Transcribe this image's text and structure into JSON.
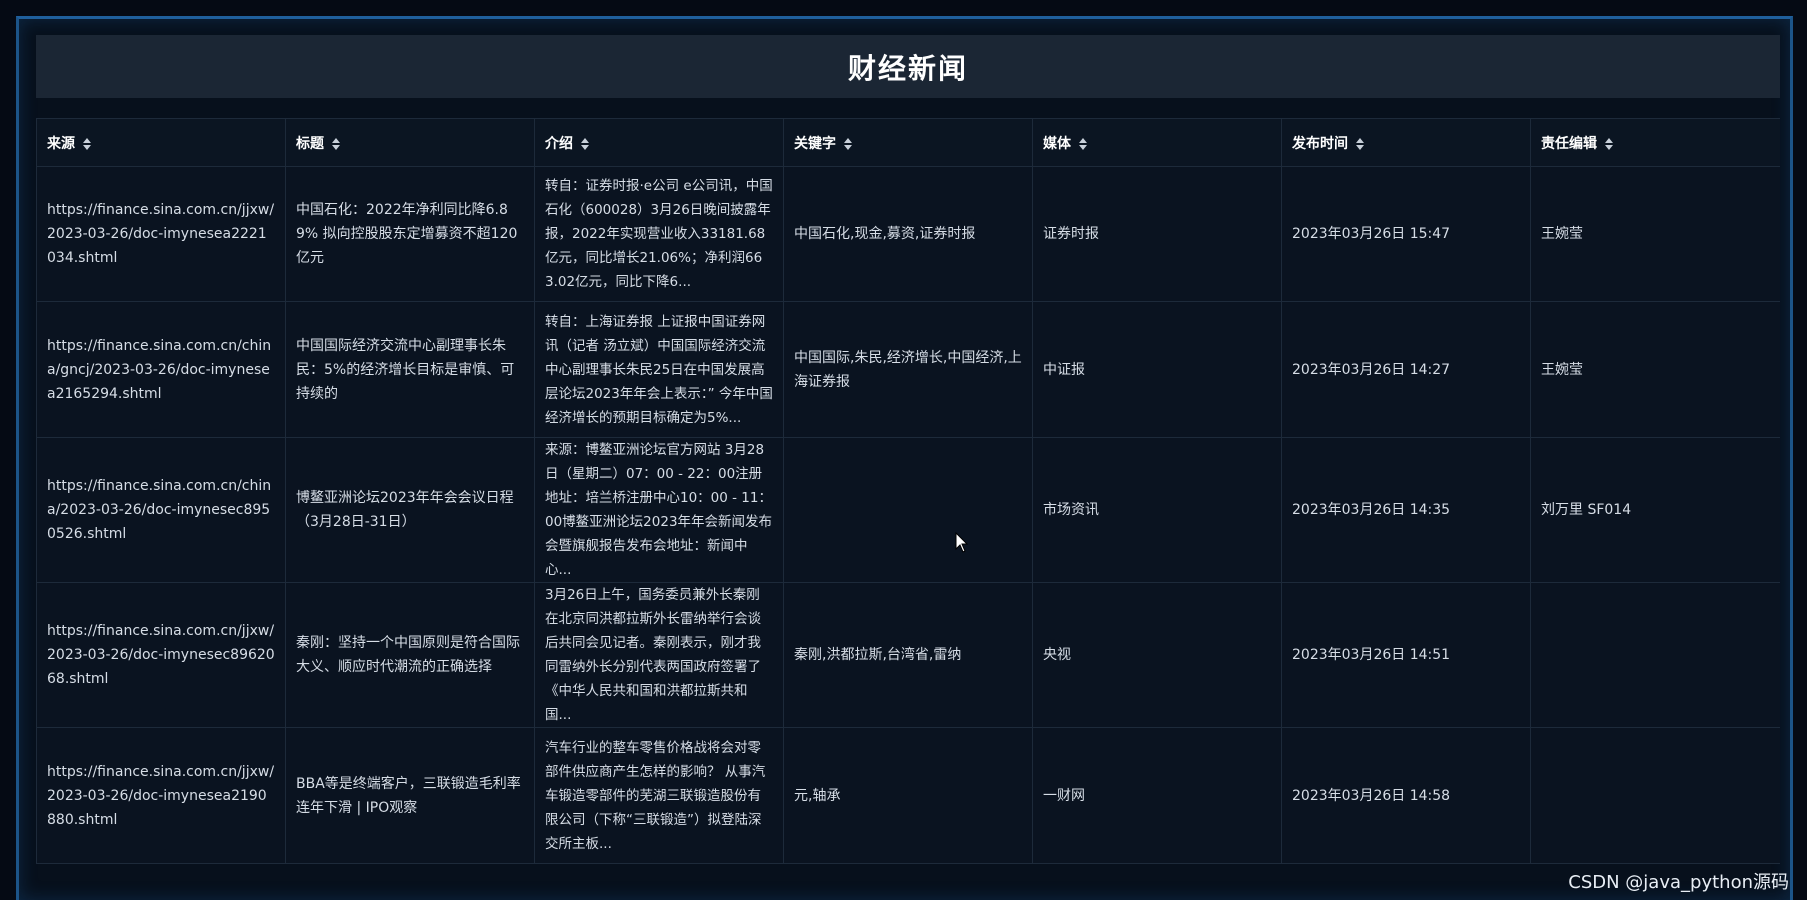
{
  "page": {
    "title": "财经新闻",
    "watermark": "CSDN @java_python源码"
  },
  "table": {
    "columns": [
      "来源",
      "标题",
      "介绍",
      "关键字",
      "媒体",
      "发布时间",
      "责任编辑"
    ],
    "rows": [
      {
        "source": "https://finance.sina.com.cn/jjxw/2023-03-26/doc-imynesea2221034.shtml",
        "title": "中国石化：2022年净利同比降6.89% 拟向控股股东定增募资不超120亿元",
        "intro": "转自：证券时报·e公司 e公司讯，中国石化（600028）3月26日晚间披露年报，2022年实现营业收入33181.68亿元，同比增长21.06%；净利润663.02亿元，同比下降6...",
        "keywords": "中国石化,现金,募资,证券时报",
        "media": "证券时报",
        "time": "2023年03月26日 15:47",
        "editor": "王婉莹"
      },
      {
        "source": "https://finance.sina.com.cn/china/gncj/2023-03-26/doc-imynesea2165294.shtml",
        "title": "中国国际经济交流中心副理事长朱民：5%的经济增长目标是审慎、可持续的",
        "intro": "转自：上海证券报 上证报中国证券网讯（记者 汤立斌）中国国际经济交流中心副理事长朱民25日在中国发展高层论坛2023年年会上表示：” 今年中国经济增长的预期目标确定为5%...",
        "keywords": "中国国际,朱民,经济增长,中国经济,上海证券报",
        "media": "中证报",
        "time": "2023年03月26日 14:27",
        "editor": "王婉莹"
      },
      {
        "source": "https://finance.sina.com.cn/china/2023-03-26/doc-imynesec8950526.shtml",
        "title": "博鳌亚洲论坛2023年年会会议日程（3月28日-31日）",
        "intro": "来源：博鳌亚洲论坛官方网站 3月28日（星期二）07：00 - 22：00注册地址：培兰桥注册中心10：00 - 11：00博鳌亚洲论坛2023年年会新闻发布会暨旗舰报告发布会地址：新闻中心...",
        "keywords": "",
        "media": "市场资讯",
        "time": "2023年03月26日 14:35",
        "editor": "刘万里 SF014"
      },
      {
        "source": "https://finance.sina.com.cn/jjxw/2023-03-26/doc-imynesec8962068.shtml",
        "title": "秦刚：坚持一个中国原则是符合国际大义、顺应时代潮流的正确选择",
        "intro": "3月26日上午，国务委员兼外长秦刚在北京同洪都拉斯外长雷纳举行会谈后共同会见记者。秦刚表示，刚才我同雷纳外长分别代表两国政府签署了《中华人民共和国和洪都拉斯共和国...",
        "keywords": "秦刚,洪都拉斯,台湾省,雷纳",
        "media": "央视",
        "time": "2023年03月26日 14:51",
        "editor": ""
      },
      {
        "source": "https://finance.sina.com.cn/jjxw/2023-03-26/doc-imynesea2190880.shtml",
        "title": "BBA等是终端客户，三联锻造毛利率连年下滑 | IPO观察",
        "intro": "汽车行业的整车零售价格战将会对零部件供应商产生怎样的影响？ 从事汽车锻造零部件的芜湖三联锻造股份有限公司（下称“三联锻造”）拟登陆深交所主板...",
        "keywords": "元,轴承",
        "media": "一财网",
        "time": "2023年03月26日 14:58",
        "editor": ""
      }
    ]
  }
}
